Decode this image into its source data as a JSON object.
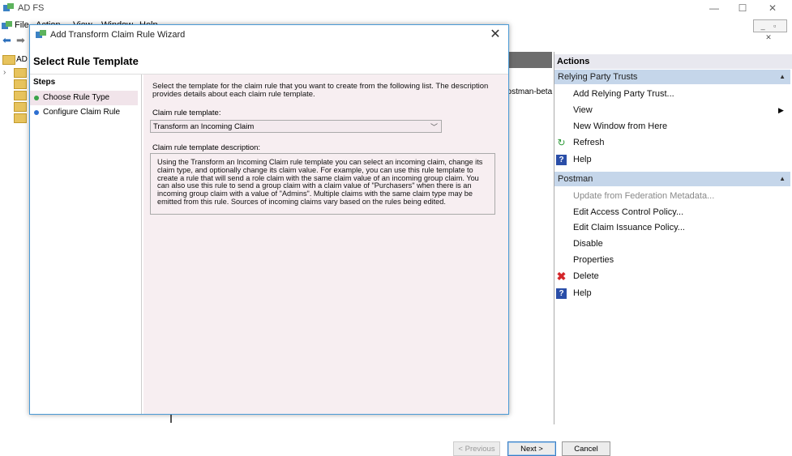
{
  "app": {
    "title": "AD FS",
    "menu": [
      "File",
      "Action",
      "View",
      "Window",
      "Help"
    ],
    "mdi_buttons": "_ ▫ ✕",
    "window_buttons": {
      "minimize": "—",
      "maximize": "☐",
      "close": "✕"
    }
  },
  "tree": {
    "root_label": "AD"
  },
  "list": {
    "row_text": "postman-beta"
  },
  "actions": {
    "title": "Actions",
    "groups": [
      {
        "header": "Relying Party Trusts",
        "items": [
          {
            "label": "Add Relying Party Trust...",
            "icon": ""
          },
          {
            "label": "View",
            "icon": "",
            "submenu": true
          },
          {
            "label": "New Window from Here",
            "icon": ""
          },
          {
            "label": "Refresh",
            "icon": "refresh-icon"
          },
          {
            "label": "Help",
            "icon": "help-icon"
          }
        ]
      },
      {
        "header": "Postman",
        "items": [
          {
            "label": "Update from Federation Metadata...",
            "icon": "",
            "disabled": true
          },
          {
            "label": "Edit Access Control Policy...",
            "icon": ""
          },
          {
            "label": "Edit Claim Issuance Policy...",
            "icon": ""
          },
          {
            "label": "Disable",
            "icon": ""
          },
          {
            "label": "Properties",
            "icon": ""
          },
          {
            "label": "Delete",
            "icon": "delete-icon"
          },
          {
            "label": "Help",
            "icon": "help-icon"
          }
        ]
      }
    ]
  },
  "dialog": {
    "title": "Add Transform Claim Rule Wizard",
    "heading": "Select Rule Template",
    "steps_label": "Steps",
    "steps": [
      {
        "label": "Choose Rule Type",
        "color": "#3aa34a",
        "active": true
      },
      {
        "label": "Configure Claim Rule",
        "color": "#2d6fd1",
        "active": false
      }
    ],
    "intro": "Select the template for the claim rule that you want to create from the following list. The description provides details about each claim rule template.",
    "template_label": "Claim rule template:",
    "template_value": "Transform an Incoming Claim",
    "description_label": "Claim rule template description:",
    "description": "Using the Transform an Incoming Claim rule template you can select an incoming claim, change its claim type, and optionally change its claim value.  For example, you can use this rule template to create a rule that will send a role claim with the same claim value of an incoming group claim.  You can also use this rule to send a group claim with a claim value of \"Purchasers\" when there is an incoming group claim with a value of \"Admins\".  Multiple claims with the same claim type may be emitted from this rule.  Sources of incoming claims vary based on the rules being edited.",
    "buttons": {
      "previous": "< Previous",
      "next": "Next >",
      "cancel": "Cancel"
    }
  },
  "colors": {
    "accent": "#4a9ad6",
    "action_header": "#c5d6ea",
    "wizard_bg": "#f7eef1"
  }
}
